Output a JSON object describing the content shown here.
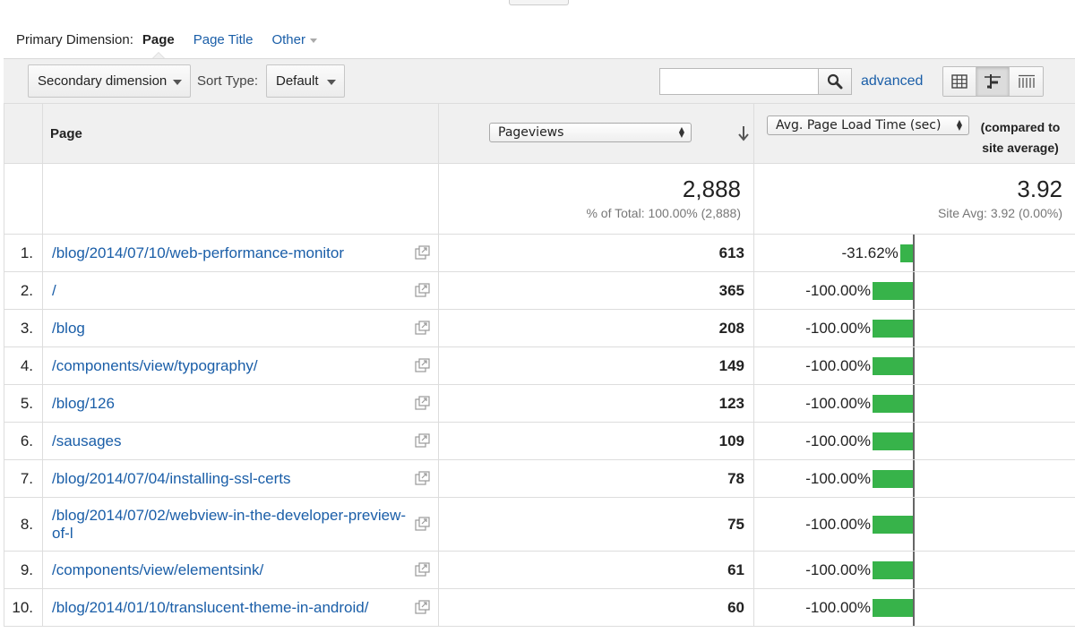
{
  "primary_dimension": {
    "label": "Primary Dimension:",
    "active": "Page",
    "links": [
      "Page Title",
      "Other"
    ]
  },
  "toolbar": {
    "secondary_dimension": "Secondary dimension",
    "sort_type_label": "Sort Type:",
    "sort_type_value": "Default",
    "search_placeholder": "",
    "advanced": "advanced"
  },
  "table": {
    "col_page": "Page",
    "col_pageviews_select": "Pageviews",
    "col_compare_select": "Avg. Page Load Time (sec)",
    "col_compare_suffix": "(compared to site average)",
    "summary": {
      "pageviews_total": "2,888",
      "pageviews_pct": "% of Total: 100.00% (2,888)",
      "load_time": "3.92",
      "site_avg": "Site Avg: 3.92 (0.00%)"
    },
    "rows": [
      {
        "num": "1.",
        "page": "/blog/2014/07/10/web-performance-monitor",
        "pageviews": "613",
        "compare": "-31.62%",
        "compare_value": -31.62
      },
      {
        "num": "2.",
        "page": "/",
        "pageviews": "365",
        "compare": "-100.00%",
        "compare_value": -100
      },
      {
        "num": "3.",
        "page": "/blog",
        "pageviews": "208",
        "compare": "-100.00%",
        "compare_value": -100
      },
      {
        "num": "4.",
        "page": "/components/view/typography/",
        "pageviews": "149",
        "compare": "-100.00%",
        "compare_value": -100
      },
      {
        "num": "5.",
        "page": "/blog/126",
        "pageviews": "123",
        "compare": "-100.00%",
        "compare_value": -100
      },
      {
        "num": "6.",
        "page": "/sausages",
        "pageviews": "109",
        "compare": "-100.00%",
        "compare_value": -100
      },
      {
        "num": "7.",
        "page": "/blog/2014/07/04/installing-ssl-certs",
        "pageviews": "78",
        "compare": "-100.00%",
        "compare_value": -100
      },
      {
        "num": "8.",
        "page": "/blog/2014/07/02/webview-in-the-developer-preview-of-l",
        "pageviews": "75",
        "compare": "-100.00%",
        "compare_value": -100
      },
      {
        "num": "9.",
        "page": "/components/view/elementsink/",
        "pageviews": "61",
        "compare": "-100.00%",
        "compare_value": -100
      },
      {
        "num": "10.",
        "page": "/blog/2014/01/10/translucent-theme-in-android/",
        "pageviews": "60",
        "compare": "-100.00%",
        "compare_value": -100
      }
    ]
  },
  "colors": {
    "bar": "#37b34a",
    "link": "#1a5ea8"
  },
  "icons": {
    "search": "search-icon",
    "external": "external-link-icon",
    "views": [
      "table-view-icon",
      "comparison-view-icon",
      "pivot-view-icon"
    ]
  }
}
